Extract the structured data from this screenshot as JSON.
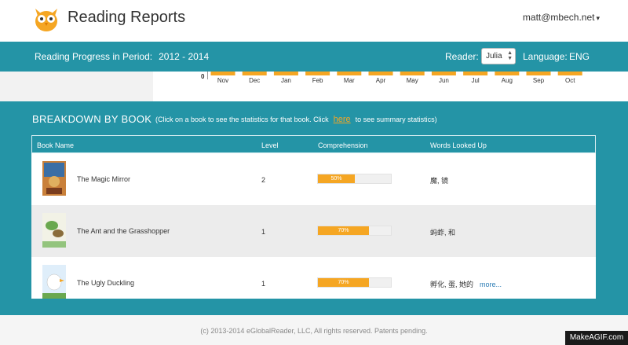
{
  "header": {
    "title": "Reading Reports",
    "user_email": "matt@mbech.net",
    "user_caret": "▾"
  },
  "topbar": {
    "period_label": "Reading Progress in Period:",
    "period_value": "2012 - 2014",
    "reader_label": "Reader:",
    "reader_value": "Julia",
    "language_label": "Language:",
    "language_value": "ENG"
  },
  "chart_data": {
    "type": "bar",
    "categories": [
      "Nov",
      "Dec",
      "Jan",
      "Feb",
      "Mar",
      "Apr",
      "May",
      "Jun",
      "Jul",
      "Aug",
      "Sep",
      "Oct"
    ],
    "ylim_label": "0",
    "bar_color": "#f5a623"
  },
  "breakdown": {
    "title": "BREAKDOWN BY BOOK",
    "hint_before": "(Click on a book to see the statistics for that book. Click",
    "hint_link": "here",
    "hint_after": "to see summary statistics)",
    "columns": [
      "Book Name",
      "Level",
      "Comprehension",
      "Words Looked Up"
    ],
    "rows": [
      {
        "name": "The Magic Mirror",
        "level": "2",
        "comprehension": "50%",
        "comprehension_fraction": 0.5,
        "words": "魔, 镜",
        "more": ""
      },
      {
        "name": "The Ant and the Grasshopper",
        "level": "1",
        "comprehension": "70%",
        "comprehension_fraction": 0.7,
        "words": "蚂蚱, 和",
        "more": ""
      },
      {
        "name": "The Ugly Duckling",
        "level": "1",
        "comprehension": "70%",
        "comprehension_fraction": 0.7,
        "words": "孵化, 蛋, 她的",
        "more": "more..."
      }
    ]
  },
  "footer": {
    "copyright": "(c) 2013-2014 eGlobalReader, LLC, All rights reserved. Patents pending.",
    "watermark": "MakeAGIF.com"
  },
  "colors": {
    "teal": "#2494a6",
    "accent": "#f5a623"
  }
}
